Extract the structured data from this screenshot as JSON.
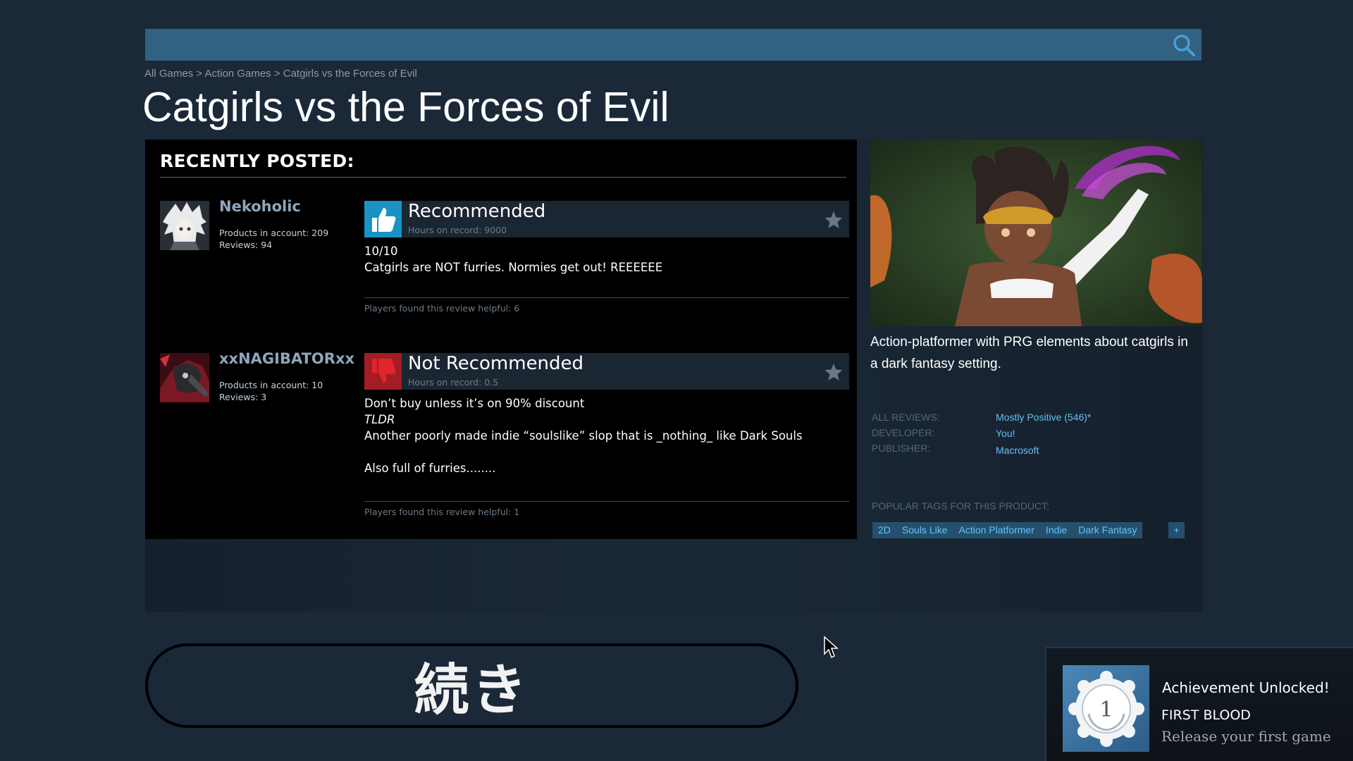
{
  "search": {
    "placeholder": ""
  },
  "breadcrumb": "All Games > Action Games > Catgirls vs the Forces of Evil",
  "title": "Catgirls vs the Forces of Evil",
  "reviews": {
    "heading": "RECENTLY POSTED:",
    "items": [
      {
        "author": "Nekoholic",
        "products": "Products in account: 209",
        "review_count": "Reviews: 94",
        "verdict": "Recommended",
        "hours": "Hours on record: 9000",
        "lines": [
          "10/10",
          "Catgirls are NOT furries. Normies get out! REEEEEE"
        ],
        "helpful": "Players found this review helpful: 6"
      },
      {
        "author": "xxNAGIBATORxx",
        "products": "Products in account: 10",
        "review_count": "Reviews: 3",
        "verdict": "Not Recommended",
        "hours": "Hours on record: 0.5",
        "lines": [
          "Don’t buy unless it’s on 90% discount",
          "TLDR",
          "Another poorly made indie “soulslike” slop that is _nothing_ like Dark Souls",
          "Also full of furries........"
        ],
        "helpful": "Players found this review helpful: 1"
      }
    ]
  },
  "game": {
    "description": "Action-platformer with PRG elements about catgirls in a dark fantasy setting.",
    "all_reviews_label": "ALL REVIEWS:",
    "all_reviews_value": "Mostly Positive (546)*",
    "developer_label": "DEVELOPER:",
    "developer_value": "You!",
    "publisher_label": "PUBLISHER:",
    "publisher_value": "Macrosoft",
    "tags_label": "POPULAR TAGS FOR THIS PRODUCT:",
    "tags": [
      "2D",
      "Souls Like",
      "Action Platformer",
      "Indie",
      "Dark Fantasy"
    ],
    "tag_plus": "+"
  },
  "continue_label": "続き",
  "achievement": {
    "title": "Achievement Unlocked!",
    "name": "FIRST BLOOD",
    "description": "Release your first game",
    "badge_number": "1"
  },
  "colors": {
    "background": "#1b2838",
    "search": "#316282",
    "link": "#66c0f4",
    "recommend": "#1fa5d6",
    "not_recommend": "#c0242a"
  },
  "icons": [
    "search-icon",
    "thumbs-up-icon",
    "thumbs-down-icon",
    "star-icon",
    "cursor-icon",
    "achievement-badge-icon"
  ]
}
